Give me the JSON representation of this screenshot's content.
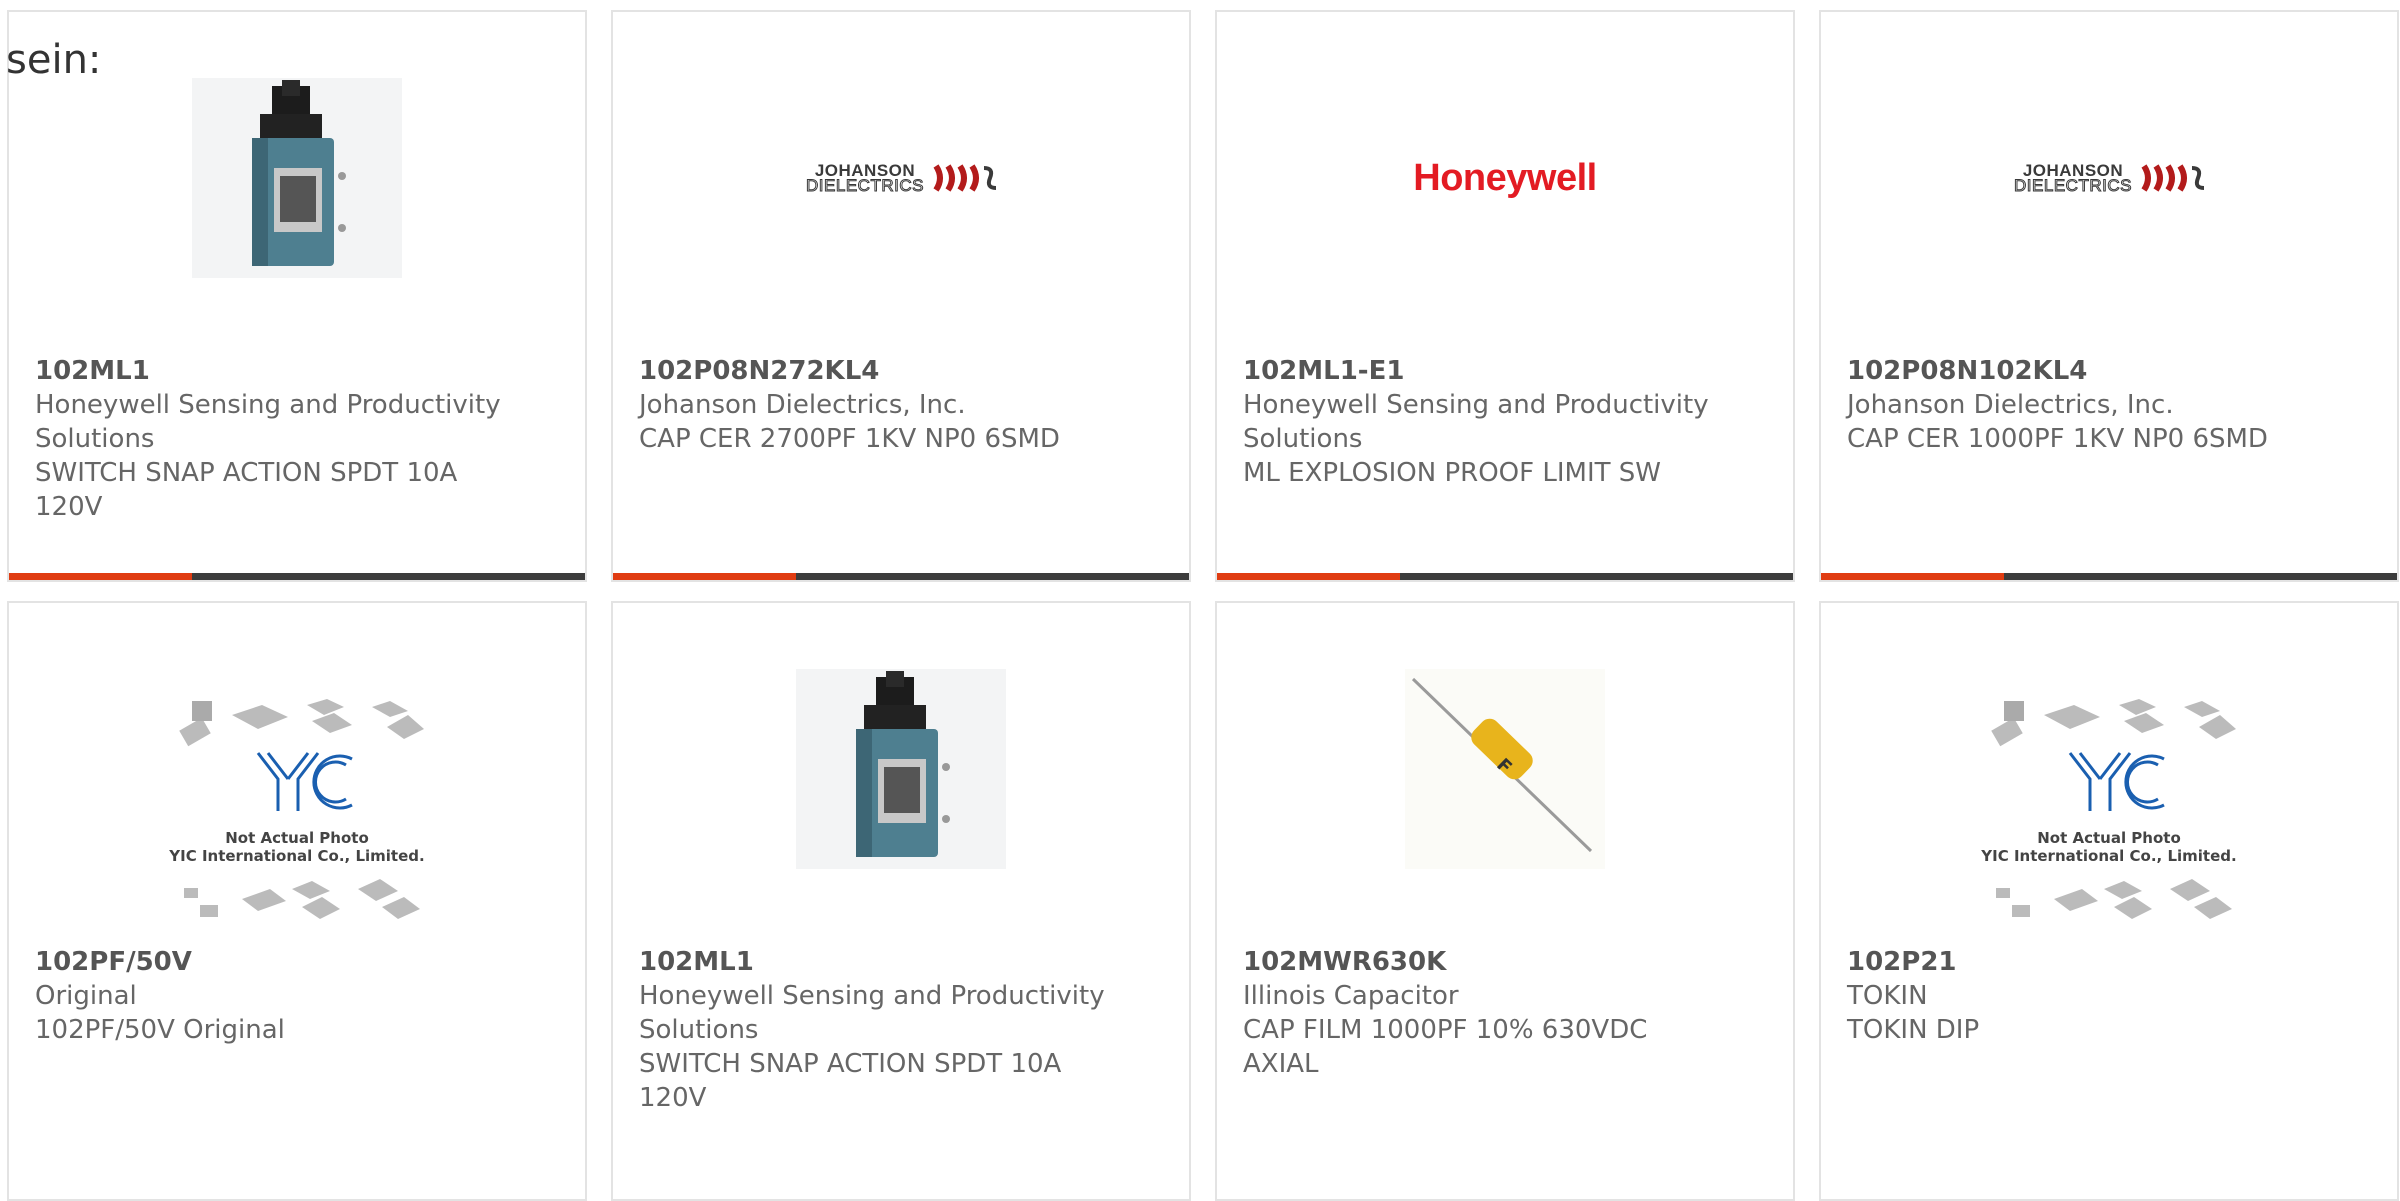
{
  "page": {
    "intro_text": "sein:"
  },
  "colors": {
    "accent": "#e03c12",
    "bar": "#3c3c3c",
    "border": "#e3e3e3",
    "part_number": "#555555",
    "text": "#666666",
    "honeywell_red": "#e31b23"
  },
  "products": [
    {
      "part_number": "102ML1",
      "manufacturer": "Honeywell Sensing and Productivity Solutions",
      "description": "SWITCH SNAP ACTION SPDT 10A 120V",
      "image": "limit-switch-photo"
    },
    {
      "part_number": "102P08N272KL4",
      "manufacturer": "Johanson Dielectrics, Inc.",
      "description": "CAP CER 2700PF 1KV NP0 6SMD",
      "image": "johanson-logo",
      "logo": {
        "line1": "JOHANSON",
        "line2": "DIELECTRICS"
      }
    },
    {
      "part_number": "102ML1-E1",
      "manufacturer": "Honeywell Sensing and Productivity Solutions",
      "description": "ML EXPLOSION PROOF LIMIT SW",
      "image": "honeywell-logo",
      "logo": {
        "text": "Honeywell"
      }
    },
    {
      "part_number": "102P08N102KL4",
      "manufacturer": "Johanson Dielectrics, Inc.",
      "description": "CAP CER 1000PF 1KV NP0 6SMD",
      "image": "johanson-logo",
      "logo": {
        "line1": "JOHANSON",
        "line2": "DIELECTRICS"
      }
    },
    {
      "part_number": "102PF/50V",
      "manufacturer": "Original",
      "description": "102PF/50V Original",
      "image": "not-actual-photo",
      "placeholder": {
        "line1": "Not Actual Photo",
        "line2": "YIC International Co., Limited."
      }
    },
    {
      "part_number": "102ML1",
      "manufacturer": "Honeywell Sensing and Productivity Solutions",
      "description": "SWITCH SNAP ACTION SPDT 10A 120V",
      "image": "limit-switch-photo"
    },
    {
      "part_number": "102MWR630K",
      "manufacturer": "Illinois Capacitor",
      "description": "CAP FILM 1000PF 10% 630VDC AXIAL",
      "image": "film-capacitor-photo"
    },
    {
      "part_number": "102P21",
      "manufacturer": "TOKIN",
      "description": "TOKIN DIP",
      "image": "not-actual-photo",
      "placeholder": {
        "line1": "Not Actual Photo",
        "line2": "YIC International Co., Limited."
      }
    }
  ]
}
